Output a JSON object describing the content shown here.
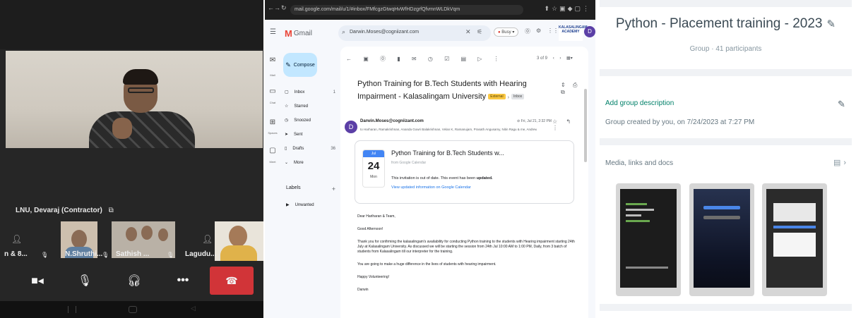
{
  "call": {
    "main_speaker_name": "LNU, Devaraj (Contractor)",
    "participants": [
      {
        "label": "n & 8..."
      },
      {
        "label": "N.Shruthi..."
      },
      {
        "label": "Sathish ..."
      },
      {
        "label": "Lagudu..."
      }
    ],
    "controls": [
      "camera-toggle",
      "mic-muted",
      "audio-output",
      "more-options",
      "end-call"
    ],
    "colors": {
      "end_call": "#d13438"
    }
  },
  "gmail": {
    "url": "mail.google.com/mail/u/1/#inbox/FMfcgzGtwqHvWfHDzgrfQfvmnWLDkVqm",
    "app_name": "Gmail",
    "search_query": "Darwin.Moses@cogniizant.com",
    "status": "Busy",
    "brand": "KALASALINGAM ACADEMY",
    "compose": "Compose",
    "folders": [
      {
        "label": "Inbox",
        "count": "1"
      },
      {
        "label": "Starred",
        "count": ""
      },
      {
        "label": "Snoozed",
        "count": ""
      },
      {
        "label": "Sent",
        "count": ""
      },
      {
        "label": "Drafts",
        "count": "36"
      },
      {
        "label": "More",
        "count": ""
      }
    ],
    "rail": [
      {
        "label": "Mail"
      },
      {
        "label": "Chat"
      },
      {
        "label": "Spaces"
      },
      {
        "label": "Meet"
      }
    ],
    "labels_heading": "Labels",
    "labels": [
      "Unwanted"
    ],
    "pager": "3 of 9",
    "subject": "Python Training for B.Tech Students with Hearing Impairment - Kalasalingam University",
    "tag_external": "External",
    "tag_inbox": "Inbox",
    "sender": "Darwin.Moses@cogniizant.com",
    "time": "Fri, Jul 21, 2:32 PM",
    "to": "to Harharan, Ramakrishnan, Ananda Gowri Balakrishnan, Velan K, Ramanujam, Prasath Angusamy, Nitin Ragu & me, Andrew Abrahamson",
    "invite": {
      "month": "Jul",
      "day": "24",
      "dow": "Mon",
      "title": "Python Training for B.Tech Students w...",
      "from": "from Google Calendar",
      "note_prefix": "This invitation is out of date. This event has been",
      "note_bold": "updated.",
      "link": "View updated information on Google Calendar"
    },
    "body": [
      "Dear Hariharan & Team,",
      "Good Afternoon!",
      "Thank you for confirming the kalasalingam's availability for conducting Python training to the students with Hearing impairment starting 24th July at Kalasalingam University. As discussed we will be starting the session from 24th Jul 10:00 AM to 1:00 PM, Daily, from 3 batch of students from Kalasalingam till our interpreter for the training.",
      "You are going to make a huge difference in the lives of students with hearing impairment.",
      "Happy Volunteering!",
      "Darwin"
    ]
  },
  "whatsapp": {
    "group_name": "Python - Placement training - 2023",
    "group_meta": "Group · 41 participants",
    "add_description": "Add group description",
    "created": "Group created by you, on 7/24/2023 at 7:27 PM",
    "media_heading": "Media, links and docs",
    "colors": {
      "accent": "#008069"
    }
  }
}
